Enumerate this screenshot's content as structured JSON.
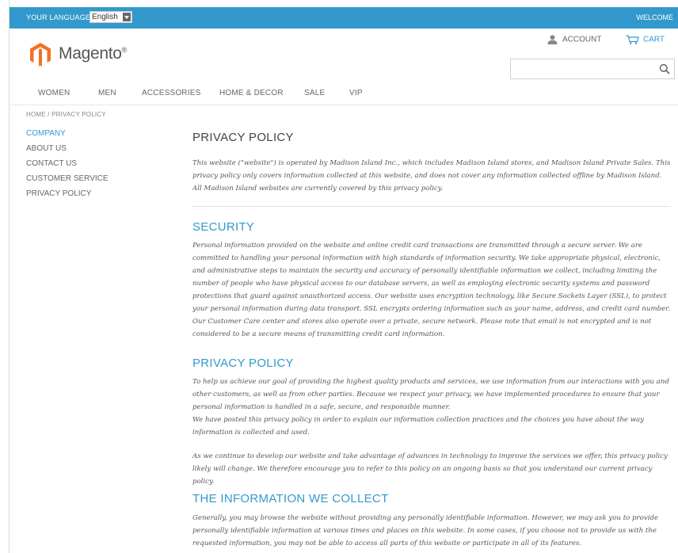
{
  "topbar": {
    "language_label": "YOUR LANGUAGE:",
    "language_value": "English",
    "welcome": "WELCOME"
  },
  "brand": {
    "name": "Magento",
    "mark": "®",
    "logo_color": "#f46f25"
  },
  "header": {
    "account": "ACCOUNT",
    "cart": "CART",
    "search_placeholder": ""
  },
  "nav": [
    "WOMEN",
    "MEN",
    "ACCESSORIES",
    "HOME & DECOR",
    "SALE",
    "VIP"
  ],
  "breadcrumb": "HOME / PRIVACY POLICY",
  "sidebar": {
    "heading": "COMPANY",
    "items": [
      "ABOUT US",
      "CONTACT US",
      "CUSTOMER SERVICE",
      "PRIVACY POLICY"
    ]
  },
  "content": {
    "title": "PRIVACY POLICY",
    "intro": "This website (\"website\") is operated by Madison Island Inc., which includes Madison Island stores, and Madison Island Private Sales. This privacy policy only covers information collected at this website, and does not cover any information collected offline by Madison Island. All Madison Island websites are currently covered by this privacy policy.",
    "sections": [
      {
        "heading": "SECURITY",
        "paragraphs": [
          "Personal information provided on the website and online credit card transactions are transmitted through a secure server. We are committed to handling your personal information with high standards of information security. We take appropriate physical, electronic, and administrative steps to maintain the security and accuracy of personally identifiable information we collect, including limiting the number of people who have physical access to our database servers, as well as employing electronic security systems and password protections that guard against unauthorized access. Our website uses encryption technology, like Secure Sockets Layer (SSL), to protect your personal information during data transport. SSL encrypts ordering information such as your name, address, and credit card number. Our Customer Care center and stores also operate over a private, secure network. Please note that email is not encrypted and is not considered to be a secure means of transmitting credit card information."
        ]
      },
      {
        "heading": "PRIVACY POLICY",
        "paragraphs": [
          "To help us achieve our goal of providing the highest quality products and services, we use information from our interactions with you and other customers, as well as from other parties. Because we respect your privacy, we have implemented procedures to ensure that your personal information is handled in a safe, secure, and responsible manner.",
          "We have posted this privacy policy in order to explain our information collection practices and the choices you have about the way information is collected and used.",
          "As we continue to develop our website and take advantage of advances in technology to improve the services we offer, this privacy policy likely will change. We therefore encourage you to refer to this policy on an ongoing basis so that you understand our current privacy policy."
        ]
      },
      {
        "heading": "THE INFORMATION WE COLLECT",
        "paragraphs": [
          "Generally, you may browse the website without providing any personally identifiable information. However, we may ask you to provide personally identifiable information at various times and places on this website. In some cases, if you choose not to provide us with the requested information, you may not be able to access all parts of this website or participate in all of its features."
        ]
      }
    ]
  },
  "colors": {
    "accent": "#3399cc",
    "text": "#555555"
  }
}
